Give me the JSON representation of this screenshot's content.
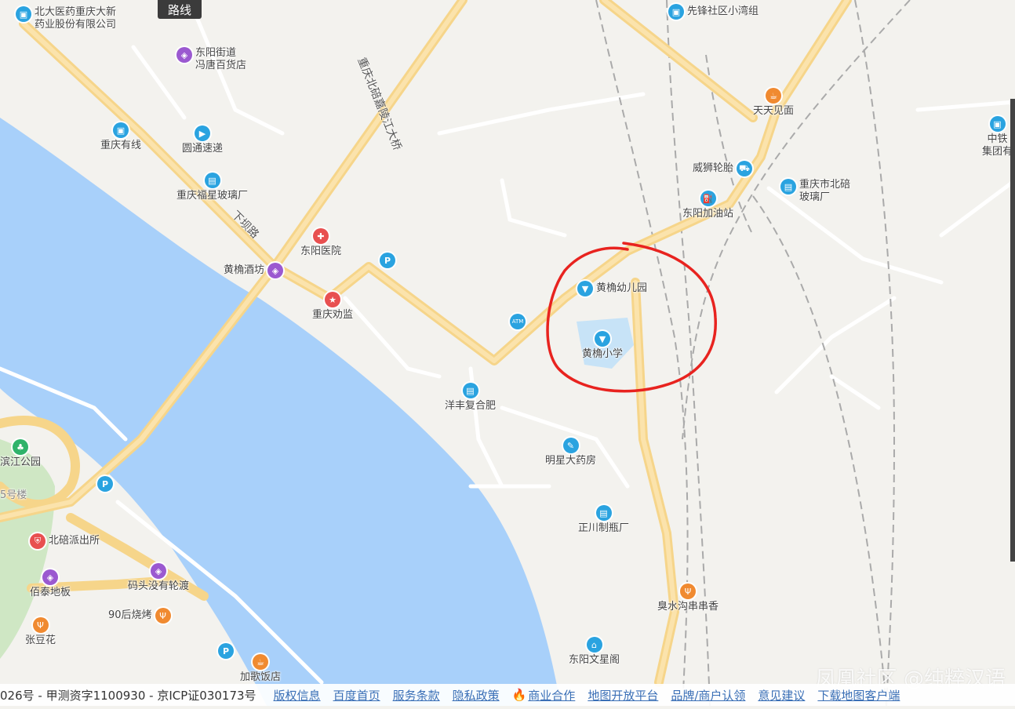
{
  "map": {
    "route_button": "路线",
    "road_labels": {
      "bridge": "重庆北碚嘉陵江大桥",
      "xiaba_road": "下坝路"
    },
    "pois": [
      {
        "id": "beida",
        "label": "北大医药重庆大新\n药业股份有限公司",
        "icon": "building-icon",
        "color": "blue"
      },
      {
        "id": "dongyang-store",
        "label": "东阳街道\n冯唐百货店",
        "icon": "shopping-icon",
        "color": "purple"
      },
      {
        "id": "cq-youxian",
        "label": "重庆有线",
        "icon": "building-icon",
        "color": "blue"
      },
      {
        "id": "yuantong",
        "label": "圆通速递",
        "icon": "delivery-icon",
        "color": "blue"
      },
      {
        "id": "fuxing-glass",
        "label": "重庆福星玻璃厂",
        "icon": "factory-icon",
        "color": "blue"
      },
      {
        "id": "dongyang-hospital",
        "label": "东阳医院",
        "icon": "hospital-icon",
        "color": "red"
      },
      {
        "id": "huangjue-winery",
        "label": "黄桷酒坊",
        "icon": "shopping-icon",
        "color": "purple"
      },
      {
        "id": "cq-prison",
        "label": "重庆劝监",
        "icon": "government-icon",
        "color": "red"
      },
      {
        "id": "xianfeng",
        "label": "先锋社区小湾组",
        "icon": "building-icon",
        "color": "blue"
      },
      {
        "id": "tiantian",
        "label": "天天见面",
        "icon": "food-icon",
        "color": "orange"
      },
      {
        "id": "weishi-tire",
        "label": "威狮轮胎",
        "icon": "car-icon",
        "color": "blue"
      },
      {
        "id": "beibei-glass",
        "label": "重庆市北碚\n玻璃厂",
        "icon": "factory-icon",
        "color": "blue"
      },
      {
        "id": "dongyang-gas",
        "label": "东阳加油站",
        "icon": "gas-station-icon",
        "color": "blue"
      },
      {
        "id": "zhongtie",
        "label": "中铁\n集团有",
        "icon": "building-icon",
        "color": "blue"
      },
      {
        "id": "kindergarten",
        "label": "黄桷幼儿园",
        "icon": "school-icon",
        "color": "blue"
      },
      {
        "id": "primary-school",
        "label": "黄桷小学",
        "icon": "school-icon",
        "color": "blue"
      },
      {
        "id": "yangfeng",
        "label": "洋丰复合肥",
        "icon": "factory-icon",
        "color": "blue"
      },
      {
        "id": "mingxing",
        "label": "明星大药房",
        "icon": "pharmacy-icon",
        "color": "blue"
      },
      {
        "id": "zhengchuan",
        "label": "正川制瓶厂",
        "icon": "factory-icon",
        "color": "blue"
      },
      {
        "id": "choushuigou",
        "label": "臭水沟串串香",
        "icon": "food-icon",
        "color": "orange"
      },
      {
        "id": "wenxingge",
        "label": "东阳文星阁",
        "icon": "landmark-icon",
        "color": "blue"
      },
      {
        "id": "binjiang-park",
        "label": "滨江公园",
        "icon": "park-icon",
        "color": "green"
      },
      {
        "id": "beibei-police",
        "label": "北碚派出所",
        "icon": "police-icon",
        "color": "red"
      },
      {
        "id": "matou-ferry",
        "label": "码头没有轮渡",
        "icon": "shopping-icon",
        "color": "purple"
      },
      {
        "id": "baitai",
        "label": "佰泰地板",
        "icon": "shopping-icon",
        "color": "purple"
      },
      {
        "id": "90hou-bbq",
        "label": "90后烧烤",
        "icon": "food-icon",
        "color": "orange"
      },
      {
        "id": "zhangdouhua",
        "label": "张豆花",
        "icon": "food-icon",
        "color": "orange"
      },
      {
        "id": "jiage-hotel",
        "label": "加歌饭店",
        "icon": "food-icon",
        "color": "orange"
      },
      {
        "id": "building-no",
        "label": "5号楼",
        "icon": "",
        "color": "blue"
      },
      {
        "id": "parking-1",
        "label": "",
        "icon": "parking-icon",
        "color": "blue"
      },
      {
        "id": "parking-2",
        "label": "",
        "icon": "parking-icon",
        "color": "blue"
      },
      {
        "id": "parking-3",
        "label": "",
        "icon": "parking-icon",
        "color": "blue"
      },
      {
        "id": "atm",
        "label": "ATM",
        "icon": "atm-icon",
        "color": "blue"
      }
    ]
  },
  "footer": {
    "license": "026号 - 甲测资字1100930 - 京ICP证030173号",
    "links": [
      "版权信息",
      "百度首页",
      "服务条款",
      "隐私政策",
      "商业合作",
      "地图开放平台",
      "品牌/商户认领",
      "意见建议",
      "下载地图客户端"
    ],
    "watermark": "凤凰社区 @纯粹汉语"
  },
  "colors": {
    "river": "#a8d0fa",
    "road_major": "#f6d58a",
    "road_minor": "#ffffff",
    "circle": "#e8231f"
  }
}
